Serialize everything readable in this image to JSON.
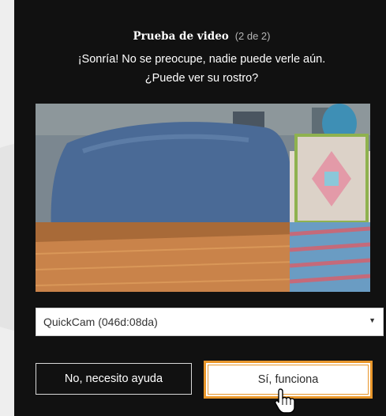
{
  "dialog": {
    "title": "Prueba de video",
    "step": "(2 de 2)",
    "subtitle_line1": "¡Sonría! No se preocupe, nadie puede verle aún.",
    "subtitle_line2": "¿Puede ver su rostro?"
  },
  "camera_select": {
    "selected": "QuickCam (046d:08da)",
    "arrow_icon": "dropdown-arrow-icon"
  },
  "buttons": {
    "no_label": "No, necesito ayuda",
    "yes_label": "Sí, funciona"
  },
  "colors": {
    "dialog_bg": "#111111",
    "accent_border": "#e8962a",
    "page_bg": "#eeeeee"
  },
  "cursor_icon": "hand-pointer-icon"
}
